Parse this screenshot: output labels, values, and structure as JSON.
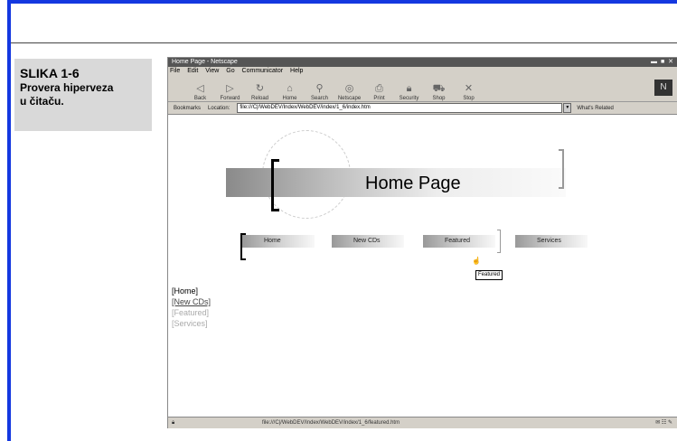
{
  "caption": {
    "figure_label": "SLIKA 1-6",
    "text_line1": "Provera hiperveza",
    "text_line2": "u čitaču."
  },
  "browser": {
    "title": "Home Page - Netscape",
    "window_controls": "▬ ■ ✕",
    "menu": [
      "File",
      "Edit",
      "View",
      "Go",
      "Communicator",
      "Help"
    ],
    "toolbar": [
      {
        "label": "Back",
        "icon": "back-arrow-icon"
      },
      {
        "label": "Forward",
        "icon": "forward-arrow-icon"
      },
      {
        "label": "Reload",
        "icon": "reload-icon"
      },
      {
        "label": "Home",
        "icon": "home-icon"
      },
      {
        "label": "Search",
        "icon": "search-icon"
      },
      {
        "label": "Netscape",
        "icon": "netscape-icon"
      },
      {
        "label": "Print",
        "icon": "print-icon"
      },
      {
        "label": "Security",
        "icon": "lock-icon"
      },
      {
        "label": "Shop",
        "icon": "shop-icon"
      },
      {
        "label": "Stop",
        "icon": "stop-icon"
      }
    ],
    "address": {
      "bookmarks_label": "Bookmarks",
      "location_label": "Location:",
      "url": "file:///C|/WebDEV/Index/WebDEV/index/1_6/index.htm",
      "related_links": "What's Related"
    },
    "page": {
      "banner_title": "Home Page",
      "nav_buttons": [
        "Home",
        "New CDs",
        "Featured",
        "Services"
      ],
      "tooltip": "Featured",
      "text_links": [
        "[Home]",
        "[New CDs]",
        "[Featured]",
        "[Services]"
      ]
    },
    "status": {
      "left": "",
      "middle": "file:///C|/WebDEV/Index/WebDEV/index/1_6/featured.htm",
      "right": ""
    }
  }
}
